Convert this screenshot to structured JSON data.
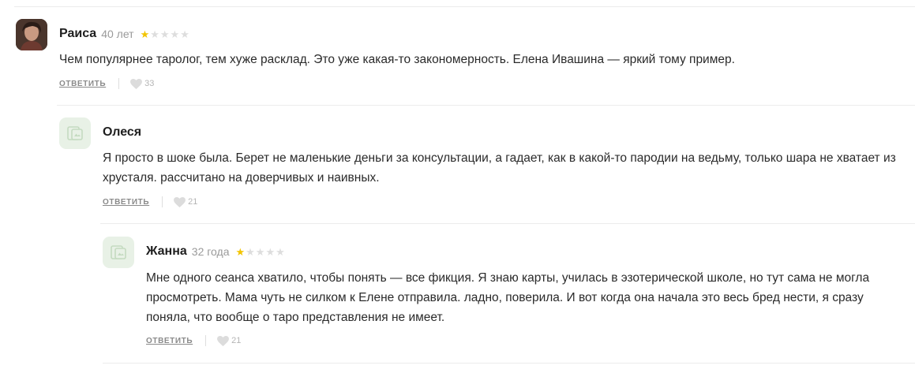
{
  "comments": [
    {
      "author": "Раиса",
      "age": "40 лет",
      "rating": 1,
      "text": "Чем популярнее таролог, тем хуже расклад. Это уже какая-то закономерность. Елена Ивашина — яркий тому пример.",
      "reply_label": "ОТВЕТИТЬ",
      "likes": "33"
    },
    {
      "author": "Олеся",
      "text": "Я просто в шоке была. Берет не маленькие деньги за консультации, а гадает, как в какой-то пародии на ведьму, только шара не хватает из хрусталя. рассчитано на доверчивых и наивных.",
      "reply_label": "ОТВЕТИТЬ",
      "likes": "21"
    },
    {
      "author": "Жанна",
      "age": "32 года",
      "rating": 1,
      "text": "Мне одного сеанса хватило, чтобы понять — все фикция. Я знаю карты, училась в эзотерической школе, но тут сама не могла просмотреть. Мама чуть не силком к Елене отправила. ладно, поверила. И вот когда она начала это весь бред нести, я сразу поняла, что вообще о таро представления не имеет.",
      "reply_label": "ОТВЕТИТЬ",
      "likes": "21"
    }
  ],
  "colors": {
    "star_filled": "#f2c400",
    "star_empty": "#dddddd",
    "avatar_placeholder_bg": "#e8f1e6",
    "divider": "#ececec"
  }
}
